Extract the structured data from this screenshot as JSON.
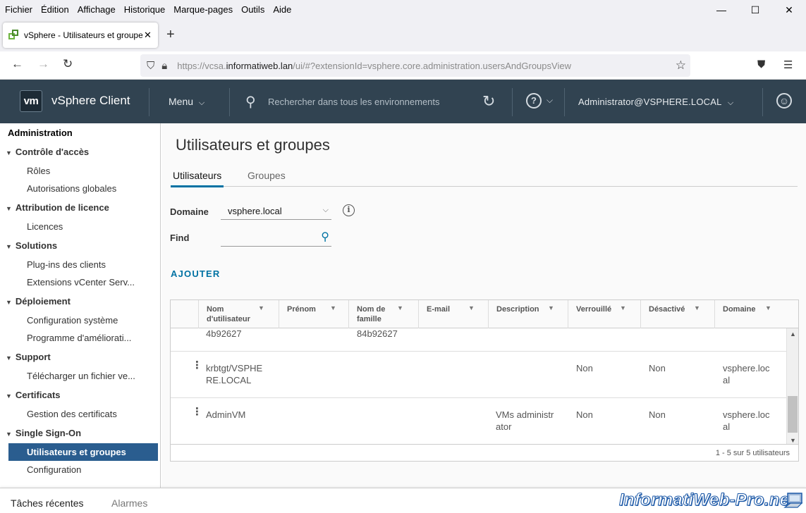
{
  "browser": {
    "menu": [
      "Fichier",
      "Édition",
      "Affichage",
      "Historique",
      "Marque-pages",
      "Outils",
      "Aide"
    ],
    "tab_title": "vSphere - Utilisateurs et groupes",
    "url_prefix": "https://vcsa.",
    "url_domain": "informatiweb.lan",
    "url_path": "/ui/#?extensionId=vsphere.core.administration.usersAndGroupsView"
  },
  "header": {
    "logo": "vm",
    "app_name": "vSphere Client",
    "menu_label": "Menu",
    "search_placeholder": "Rechercher dans tous les environnements",
    "user": "Administrator@VSPHERE.LOCAL"
  },
  "sidebar": {
    "root": "Administration",
    "sections": [
      {
        "label": "Contrôle d'accès",
        "items": [
          "Rôles",
          "Autorisations globales"
        ]
      },
      {
        "label": "Attribution de licence",
        "items": [
          "Licences"
        ]
      },
      {
        "label": "Solutions",
        "items": [
          "Plug-ins des clients",
          "Extensions vCenter Serv..."
        ]
      },
      {
        "label": "Déploiement",
        "items": [
          "Configuration système",
          "Programme d'améliorati..."
        ]
      },
      {
        "label": "Support",
        "items": [
          "Télécharger un fichier ve..."
        ]
      },
      {
        "label": "Certificats",
        "items": [
          "Gestion des certificats"
        ]
      },
      {
        "label": "Single Sign-On",
        "items": [
          "Utilisateurs et groupes",
          "Configuration"
        ]
      }
    ],
    "selected": "Utilisateurs et groupes"
  },
  "main": {
    "title": "Utilisateurs et groupes",
    "tabs": [
      "Utilisateurs",
      "Groupes"
    ],
    "active_tab": "Utilisateurs",
    "domain_label": "Domaine",
    "domain_value": "vsphere.local",
    "find_label": "Find",
    "find_value": "",
    "add_button": "AJOUTER"
  },
  "grid": {
    "columns": [
      {
        "line1": "Nom",
        "line2": "d'utilisateur"
      },
      {
        "line1": "Prénom",
        "line2": ""
      },
      {
        "line1": "Nom de",
        "line2": "famille"
      },
      {
        "line1": "E-mail",
        "line2": ""
      },
      {
        "line1": "Description",
        "line2": ""
      },
      {
        "line1": "Verrouillé",
        "line2": ""
      },
      {
        "line1": "Désactivé",
        "line2": ""
      },
      {
        "line1": "Domaine",
        "line2": ""
      }
    ],
    "partial_row": {
      "username": "4b92627",
      "lastname": "84b92627"
    },
    "rows": [
      {
        "username_l1": "krbtgt/VSPHE",
        "username_l2": "RE.LOCAL",
        "description_l1": "",
        "description_l2": "",
        "locked": "Non",
        "disabled": "Non",
        "domain_l1": "vsphere.loc",
        "domain_l2": "al"
      },
      {
        "username_l1": "AdminVM",
        "username_l2": "",
        "description_l1": "VMs administr",
        "description_l2": "ator",
        "locked": "Non",
        "disabled": "Non",
        "domain_l1": "vsphere.loc",
        "domain_l2": "al"
      }
    ],
    "footer": "1 - 5 sur 5 utilisateurs"
  },
  "bottom": {
    "recent_tasks": "Tâches récentes",
    "alarms": "Alarmes"
  },
  "watermark": "InformatiWeb-Pro.net",
  "colors": {
    "header_bg": "#314351",
    "accent": "#0072a3",
    "selected_bg": "#2a5d8f"
  }
}
